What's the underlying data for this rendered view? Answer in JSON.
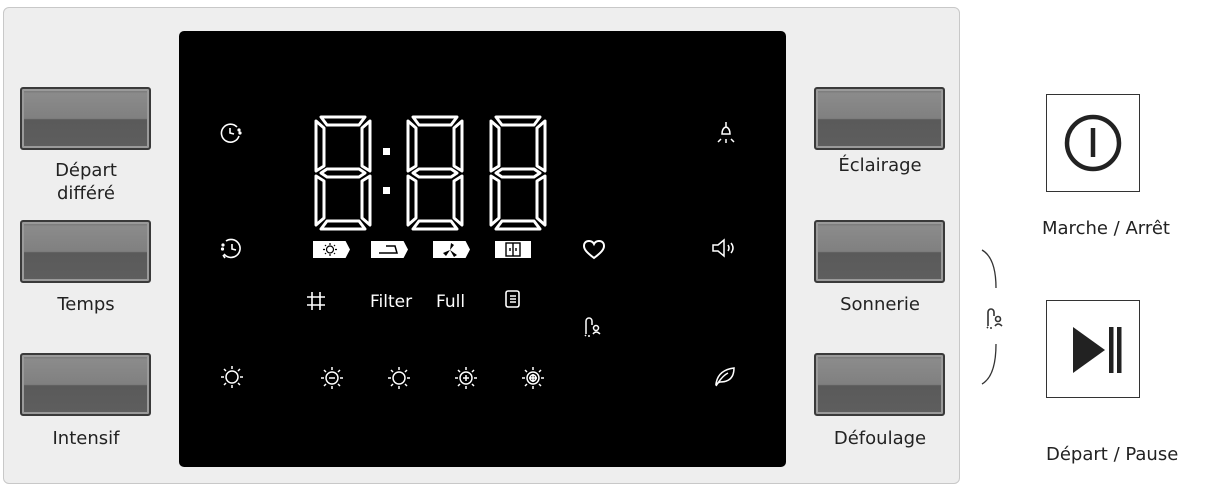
{
  "left_buttons": [
    {
      "label_line1": "Départ",
      "label_line2": "différé"
    },
    {
      "label": "Temps"
    },
    {
      "label": "Intensif"
    }
  ],
  "right_buttons": [
    {
      "label": "Éclairage"
    },
    {
      "label": "Sonnerie"
    },
    {
      "label": "Défoulage"
    }
  ],
  "display": {
    "time": "8:88",
    "filter_text": "Filter",
    "full_text": "Full"
  },
  "power": {
    "label": "Marche / Arrêt"
  },
  "start_pause": {
    "label": "Départ / Pause"
  },
  "icons": {
    "delay": "delay-clock-icon",
    "timer": "timer-clock-icon",
    "intensity": "sun-icon",
    "light": "lamp-icon",
    "sound": "speaker-icon",
    "eco": "leaf-icon",
    "favorite": "heart-icon",
    "lock": "child-lock-icon",
    "grid": "grid-icon",
    "list": "list-icon"
  },
  "colors": {
    "panel": "#eeeeee",
    "display": "#000000",
    "segment": "#ffffff"
  }
}
